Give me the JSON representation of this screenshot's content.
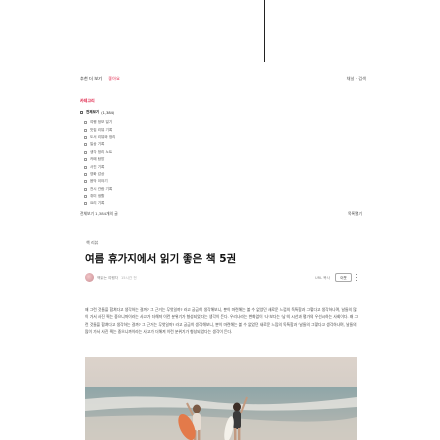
{
  "topbar": {
    "nav": [
      "추천 더 보기",
      "좋아요"
    ],
    "right": "채널 · 검색"
  },
  "sidebar": {
    "title": "카테고리",
    "all_label": "전체보기",
    "all_count": "(1,384)",
    "items": [
      "여행 정보 일기",
      "맛집 리뷰 기록",
      "도서 리뷰와 정리",
      "일상 기록",
      "생각 정리 노트",
      "카페 탐방",
      "사진 기록",
      "영화 감상",
      "음악 이야기",
      "전시 관람 기록",
      "취미 생활",
      "요리 기록"
    ]
  },
  "post_bar": {
    "left": "전체보기 1,384개의 글",
    "right": "목록열기"
  },
  "article": {
    "category": "책 리뷰",
    "title": "여름 휴가지에서 읽기 좋은 책 5권",
    "author": "책읽는 여행자",
    "time": "15시간 전",
    "stats": "URL 복사",
    "follow": "이웃",
    "paragraphs": [
      "왜 그런 것들을 합쳐다고 생각하는 걸까? 그 근거는 무엇일까? 라고 궁금히 생각해보니, 뿐이 마련해는 볼 수 없었던 새로운 느낌의 독특함과 그렇다고 생각하나며, 날들의 많이 가서 사진 찍는 중으니까이라는 사고가 더해져 이런 분위기가 형성되었다는 생각이 든다. 우리나라는 변화없이 '나'보다는 '남'의 시선과 평가의 우선시하는 사회이다. 왜 그런 것들을 합쳐다고 생각하는 걸까? 그 근거는 무엇일까? 라고 궁금히 생각해보니, 뿐이 마련해는 볼 수 없었던 새로운 느낌의 독특함과 '날들의 그렇다고 생각하나며, 날들의 많이 가서 사진 찍는 중으니까이라는 사고가 더해져 이런 분위기가 형성되었다는 생각이 든다."
    ]
  },
  "colors": {
    "accent": "#e0264b",
    "text": "#333333"
  }
}
